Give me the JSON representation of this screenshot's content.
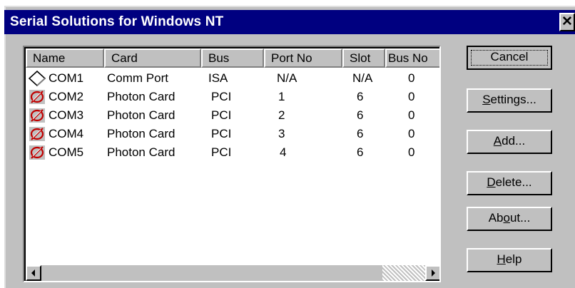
{
  "window": {
    "title": "Serial Solutions for Windows NT",
    "close_glyph": "✕"
  },
  "list": {
    "columns": [
      "Name",
      "Card",
      "Bus",
      "Port No",
      "Slot",
      "Bus No"
    ],
    "rows": [
      {
        "icon": "diamond-port-icon",
        "name": "COM1",
        "card": "Comm Port",
        "bus": "ISA",
        "port": "N/A",
        "slot": "N/A",
        "busno": "0"
      },
      {
        "icon": "photon-card-icon",
        "name": "COM2",
        "card": "Photon Card",
        "bus": "PCI",
        "port": "1",
        "slot": "6",
        "busno": "0"
      },
      {
        "icon": "photon-card-icon",
        "name": "COM3",
        "card": "Photon Card",
        "bus": "PCI",
        "port": "2",
        "slot": "6",
        "busno": "0"
      },
      {
        "icon": "photon-card-icon",
        "name": "COM4",
        "card": "Photon Card",
        "bus": "PCI",
        "port": "3",
        "slot": "6",
        "busno": "0"
      },
      {
        "icon": "photon-card-icon",
        "name": "COM5",
        "card": "Photon Card",
        "bus": "PCI",
        "port": "4",
        "slot": "6",
        "busno": "0"
      }
    ]
  },
  "buttons": {
    "cancel": "Cancel",
    "settings": {
      "pre": "",
      "key": "S",
      "post": "ettings..."
    },
    "add": {
      "pre": "",
      "key": "A",
      "post": "dd..."
    },
    "delete": {
      "pre": "",
      "key": "D",
      "post": "elete..."
    },
    "about": {
      "pre": "Ab",
      "key": "o",
      "post": "ut..."
    },
    "help": {
      "pre": "",
      "key": "H",
      "post": "elp"
    }
  }
}
